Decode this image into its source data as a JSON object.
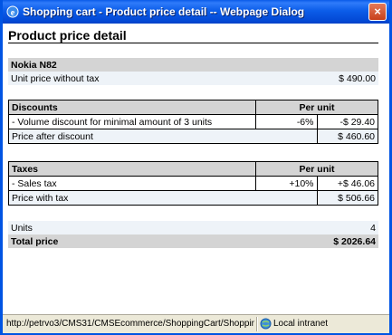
{
  "window": {
    "title": "Shopping cart - Product price detail -- Webpage Dialog",
    "close_label": "×"
  },
  "page": {
    "heading": "Product price detail"
  },
  "product": {
    "name": "Nokia N82",
    "unit_price_label": "Unit price without tax",
    "unit_price_value": "$ 490.00"
  },
  "discounts": {
    "header": "Discounts",
    "per_unit_header": "Per unit",
    "rows": [
      {
        "label": "- Volume discount for minimal amount of 3 units",
        "percent": "-6%",
        "amount": "-$ 29.40"
      }
    ],
    "after_label": "Price after discount",
    "after_value": "$ 460.60"
  },
  "taxes": {
    "header": "Taxes",
    "per_unit_header": "Per unit",
    "rows": [
      {
        "label": "- Sales tax",
        "percent": "+10%",
        "amount": "+$ 46.06"
      }
    ],
    "with_label": "Price with tax",
    "with_value": "$ 506.66"
  },
  "summary": {
    "units_label": "Units",
    "units_value": "4",
    "total_label": "Total price",
    "total_value": "$ 2026.64"
  },
  "statusbar": {
    "url": "http://petrvo3/CMS31/CMSEcommerce/ShoppingCart/ShoppingCartSKUPr",
    "zone": "Local intranet"
  },
  "icons": {
    "titlebar": "internet-explorer-icon",
    "zone": "local-intranet-icon"
  }
}
